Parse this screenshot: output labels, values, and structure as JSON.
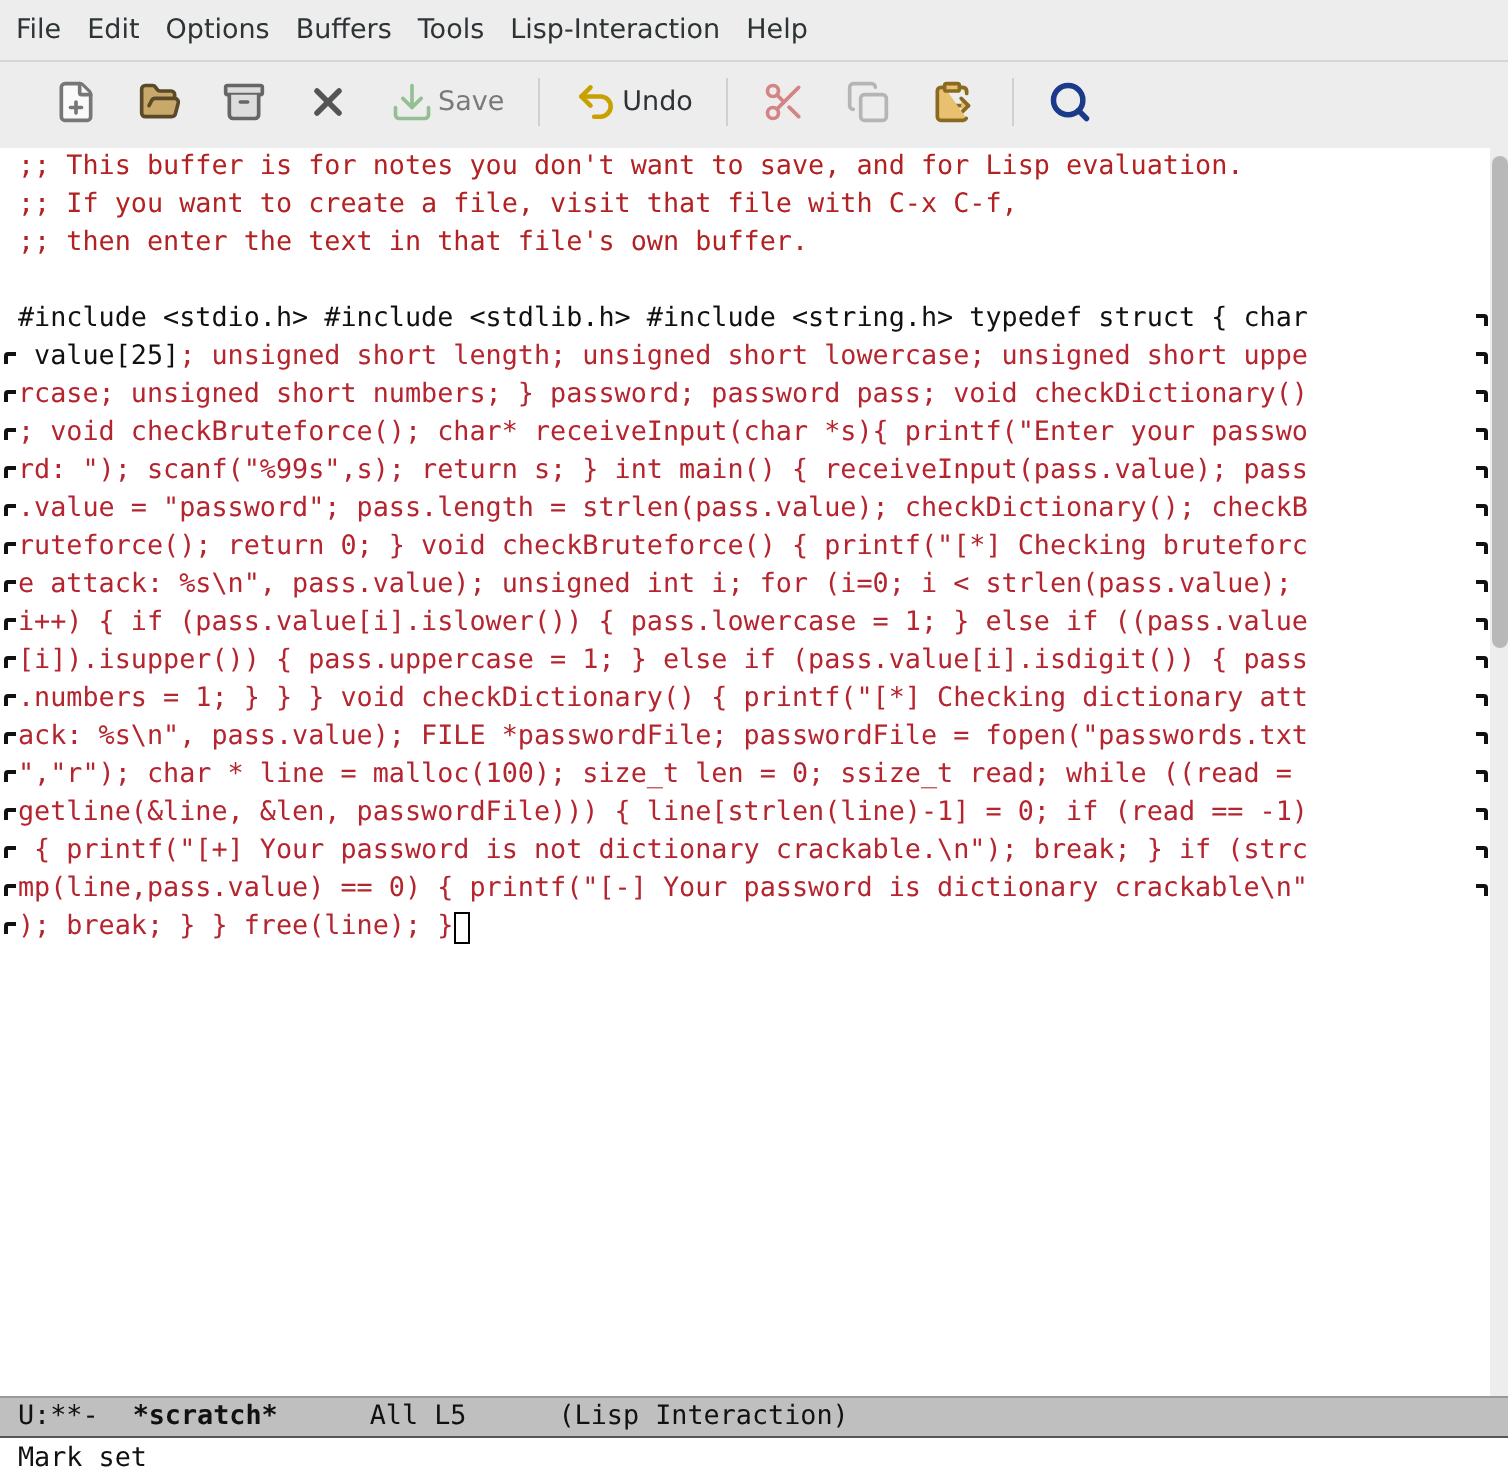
{
  "menu_bar": [
    "File",
    "Edit",
    "Options",
    "Buffers",
    "Tools",
    "Lisp-Interaction",
    "Help"
  ],
  "toolbar": {
    "groups": [
      [
        {
          "disabled": false
        },
        {
          "disabled": false
        },
        {
          "disabled": false
        },
        {
          "disabled": false
        },
        {
          "label": "Save",
          "disabled": true
        }
      ],
      [
        {
          "label": "Undo",
          "disabled": false
        }
      ],
      [
        {
          "disabled": true
        },
        {
          "disabled": true
        },
        {
          "disabled": false
        }
      ],
      [
        {
          "disabled": false
        }
      ]
    ]
  },
  "buffer": {
    "lines": [
      {
        "continued_from": false,
        "continues": false,
        "segments": [
          {
            "kind": "comment",
            "text": ";; This buffer is for notes you don't want to save, and for Lisp evaluation."
          }
        ]
      },
      {
        "continued_from": false,
        "continues": false,
        "segments": [
          {
            "kind": "comment",
            "text": ";; If you want to create a file, visit that file with C-x C-f,"
          }
        ]
      },
      {
        "continued_from": false,
        "continues": false,
        "segments": [
          {
            "kind": "comment",
            "text": ";; then enter the text in that file's own buffer."
          }
        ]
      },
      {
        "continued_from": false,
        "continues": false
      },
      {
        "continued_from": false,
        "continues": true,
        "segments": [
          {
            "kind": "code",
            "text": "#include <stdio.h> #include <stdlib.h> #include <string.h> typedef struct { char"
          }
        ]
      },
      {
        "continued_from": true,
        "continues": true,
        "segments": [
          {
            "kind": "code",
            "text": " value[25]"
          },
          {
            "kind": "string",
            "text": "; unsigned short length; unsigned short lowercase; unsigned short uppe"
          }
        ]
      },
      {
        "continued_from": true,
        "continues": true,
        "segments": [
          {
            "kind": "string",
            "text": "rcase; unsigned short numbers; } password; password pass; void checkDictionary()"
          }
        ]
      },
      {
        "continued_from": true,
        "continues": true,
        "segments": [
          {
            "kind": "string",
            "text": "; void checkBruteforce(); char* receiveInput(char *s){ printf(\"Enter your passwo"
          }
        ]
      },
      {
        "continued_from": true,
        "continues": true,
        "segments": [
          {
            "kind": "string",
            "text": "rd: \"); scanf(\"%99s\",s); return s; } int main() { receiveInput(pass.value); pass"
          }
        ]
      },
      {
        "continued_from": true,
        "continues": true,
        "segments": [
          {
            "kind": "string",
            "text": ".value = \"password\"; pass.length = strlen(pass.value); checkDictionary(); checkB"
          }
        ]
      },
      {
        "continued_from": true,
        "continues": true,
        "segments": [
          {
            "kind": "string",
            "text": "ruteforce(); return 0; } void checkBruteforce() { printf(\"[*] Checking bruteforc"
          }
        ]
      },
      {
        "continued_from": true,
        "continues": true,
        "segments": [
          {
            "kind": "string",
            "text": "e attack: %s\\n\", pass.value); unsigned int i; for (i=0; i < strlen(pass.value); "
          }
        ]
      },
      {
        "continued_from": true,
        "continues": true,
        "segments": [
          {
            "kind": "string",
            "text": "i++) { if (pass.value[i].islower()) { pass.lowercase = 1; } else if ((pass.value"
          }
        ]
      },
      {
        "continued_from": true,
        "continues": true,
        "segments": [
          {
            "kind": "string",
            "text": "[i]).isupper()) { pass.uppercase = 1; } else if (pass.value[i].isdigit()) { pass"
          }
        ]
      },
      {
        "continued_from": true,
        "continues": true,
        "segments": [
          {
            "kind": "string",
            "text": ".numbers = 1; } } } void checkDictionary() { printf(\"[*] Checking dictionary att"
          }
        ]
      },
      {
        "continued_from": true,
        "continues": true,
        "segments": [
          {
            "kind": "string",
            "text": "ack: %s\\n\", pass.value); FILE *passwordFile; passwordFile = fopen(\"passwords.txt"
          }
        ]
      },
      {
        "continued_from": true,
        "continues": true,
        "segments": [
          {
            "kind": "string",
            "text": "\",\"r\"); char * line = malloc(100); size_t len = 0; ssize_t read; while ((read = "
          }
        ]
      },
      {
        "continued_from": true,
        "continues": true,
        "segments": [
          {
            "kind": "string",
            "text": "getline(&line, &len, passwordFile))) { line[strlen(line)-1] = 0; if (read == -1)"
          }
        ]
      },
      {
        "continued_from": true,
        "continues": true,
        "segments": [
          {
            "kind": "string",
            "text": " { printf(\"[+] Your password is not dictionary crackable.\\n\"); break; } if (strc"
          }
        ]
      },
      {
        "continued_from": true,
        "continues": true,
        "segments": [
          {
            "kind": "string",
            "text": "mp(line,pass.value) == 0) { printf(\"[-] Your password is dictionary crackable\\n\""
          }
        ]
      },
      {
        "continued_from": true,
        "continues": false,
        "cursor": true,
        "segments": [
          {
            "kind": "string",
            "text": "); break; } } free(line); }"
          }
        ]
      }
    ]
  },
  "mode_line": {
    "status": "U:**-",
    "buffer_name": "*scratch*",
    "position": "All L5",
    "mode": "(Lisp Interaction)"
  },
  "echo_area": "Mark set"
}
